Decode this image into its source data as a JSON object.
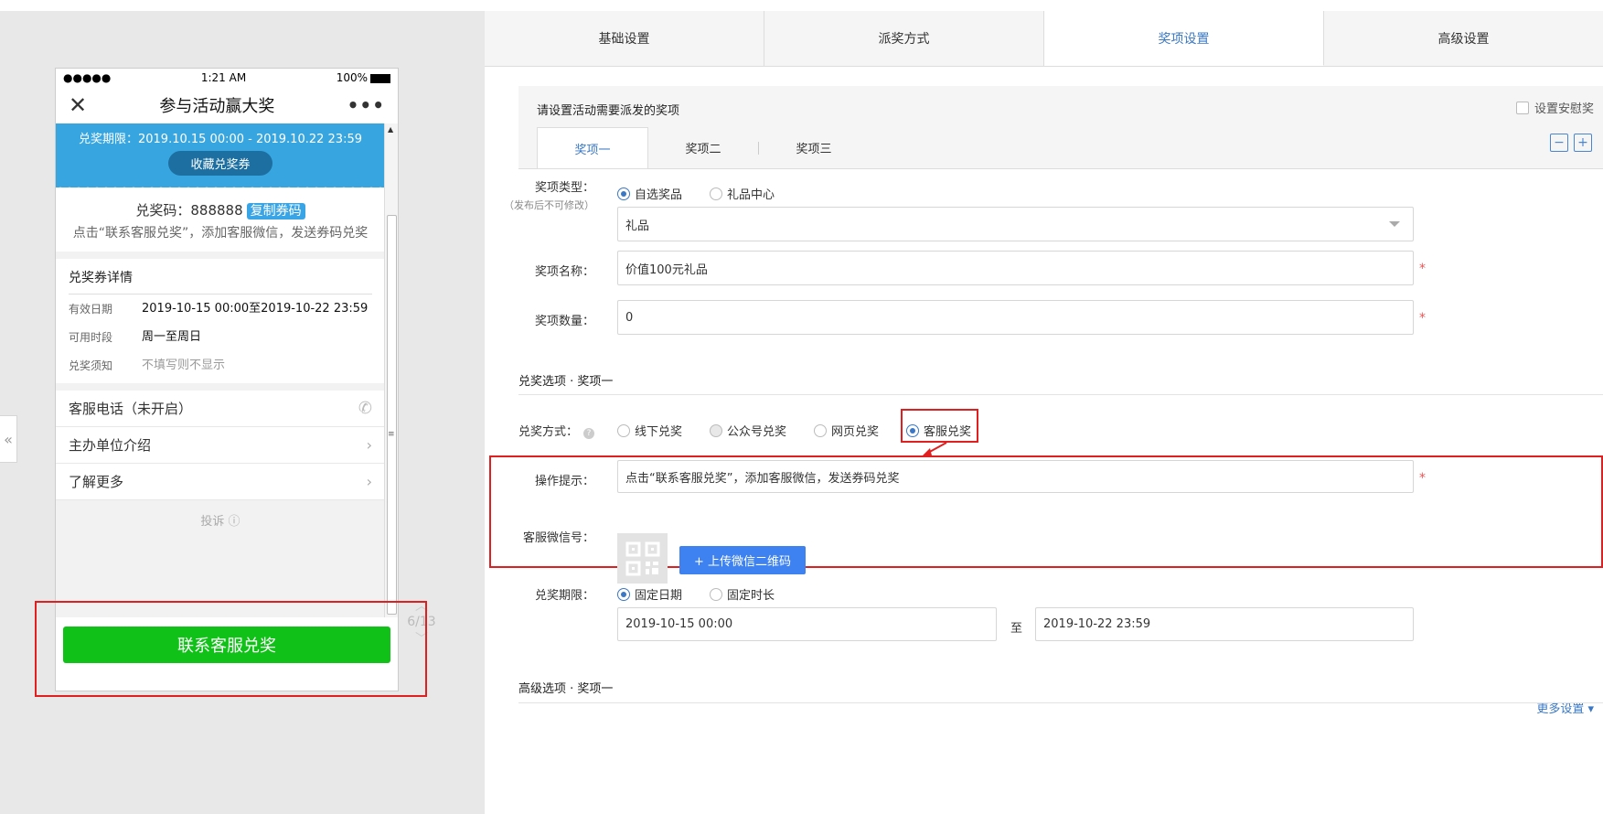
{
  "phone": {
    "signal": "●●●●●",
    "time": "1:21 AM",
    "battery": "100%",
    "title": "参与活动赢大奖",
    "close": "✕",
    "more": "•••",
    "banner_period": "兑奖期限：2019.10.15 00:00 - 2019.10.22 23:59",
    "collect_button": "收藏兑奖券",
    "code_label": "兑奖码：888888",
    "copy_button": "复制券码",
    "code_tip": "点击“联系客服兑奖”，添加客服微信，发送券码兑奖",
    "detail_title": "兑奖券详情",
    "details": [
      {
        "key": "有效日期",
        "value": "2019-10-15 00:00至2019-10-22 23:59"
      },
      {
        "key": "可用时段",
        "value": "周一至周日"
      },
      {
        "key": "兑奖须知",
        "value": "不填写则不显示"
      }
    ],
    "links": [
      {
        "label": "客服电话（未开启）"
      },
      {
        "label": "主办单位介绍"
      },
      {
        "label": "了解更多"
      }
    ],
    "complain": "投诉 ⓘ",
    "contact_button": "联系客服兑奖"
  },
  "pager": "6/13",
  "tabs": [
    {
      "label": "基础设置"
    },
    {
      "label": "派奖方式"
    },
    {
      "label": "奖项设置"
    },
    {
      "label": "高级设置"
    }
  ],
  "prize": {
    "header": "请设置活动需要派发的奖项",
    "consolation": "设置安慰奖",
    "tabs": [
      {
        "label": "奖项一"
      },
      {
        "label": "奖项二"
      },
      {
        "label": "奖项三"
      }
    ],
    "minus": "−",
    "plus": "+"
  },
  "form": {
    "type_label": "奖项类型：",
    "type_sub": "（发布后不可修改）",
    "type_options": [
      "自选奖品",
      "礼品中心"
    ],
    "type_select": "礼品",
    "name_label": "奖项名称：",
    "name_value": "价值100元礼品",
    "qty_label": "奖项数量：",
    "qty_value": "0",
    "redeem_section": "兑奖选项 · 奖项一",
    "method_label": "兑奖方式：",
    "method_options": [
      "线下兑奖",
      "公众号兑奖",
      "网页兑奖",
      "客服兑奖"
    ],
    "hint_label": "操作提示：",
    "hint_value": "点击“联系客服兑奖”，添加客服微信，发送券码兑奖",
    "wechat_label": "客服微信号：",
    "upload_button": "+ 上传微信二维码",
    "period_label": "兑奖期限：",
    "period_options": [
      "固定日期",
      "固定时长"
    ],
    "start_date": "2019-10-15 00:00",
    "to": "至",
    "end_date": "2019-10-22 23:59",
    "advanced_section": "高级选项 · 奖项一",
    "more_settings": "更多设置 ▾",
    "required": "*"
  }
}
